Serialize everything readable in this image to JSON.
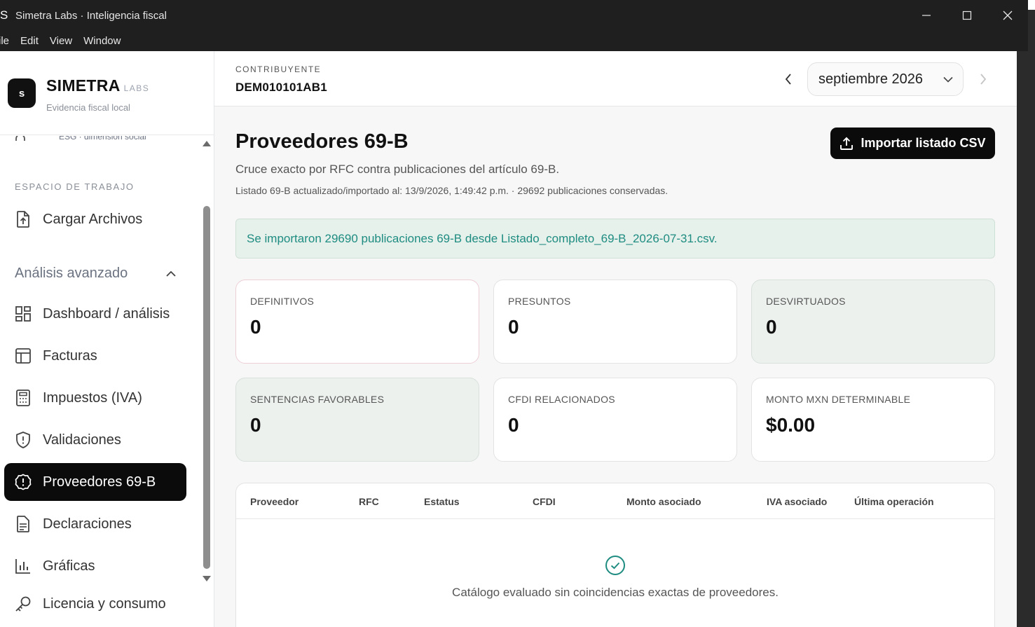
{
  "window": {
    "app_glyph": "S",
    "title": "Simetra Labs · Inteligencia fiscal",
    "controls": [
      "minimize-icon",
      "maximize-icon",
      "close-icon"
    ]
  },
  "menu": [
    "ile",
    "Edit",
    "View",
    "Window"
  ],
  "brand": {
    "logo": "s",
    "name": "SIMETRA",
    "suffix": "LABS",
    "tagline": "Evidencia fiscal local"
  },
  "sidebar": {
    "partial_item_sub": "ESG · dimensión social",
    "section_label": "ESPACIO DE TRABAJO",
    "workspace_item": {
      "label": "Cargar Archivos",
      "icon": "file-upload-icon"
    },
    "group_label": "Análisis avanzado",
    "items": [
      {
        "label": "Dashboard / análisis",
        "icon": "dashboard-icon"
      },
      {
        "label": "Facturas",
        "icon": "table-icon"
      },
      {
        "label": "Impuestos (IVA)",
        "icon": "calculator-icon"
      },
      {
        "label": "Validaciones",
        "icon": "shield-icon"
      },
      {
        "label": "Proveedores 69-B",
        "icon": "alert-circle-icon",
        "active": true
      },
      {
        "label": "Declaraciones",
        "icon": "document-icon"
      },
      {
        "label": "Gráficas",
        "icon": "bar-chart-icon"
      },
      {
        "label": "Licencia y consumo",
        "icon": "key-icon"
      }
    ]
  },
  "header": {
    "contributor_label": "CONTRIBUYENTE",
    "contributor_rfc": "DEM010101AB1",
    "period": "septiembre 2026"
  },
  "page": {
    "title": "Proveedores 69-B",
    "subtitle": "Cruce exacto por RFC contra publicaciones del artículo 69-B.",
    "meta": "Listado 69-B actualizado/importado al: 13/9/2026, 1:49:42 p.m. · 29692 publicaciones conservadas.",
    "import_button": "Importar listado CSV",
    "alert": "Se importaron 29690 publicaciones 69-B desde Listado_completo_69-B_2026-07-31.csv."
  },
  "stats": [
    {
      "label": "DEFINITIVOS",
      "value": "0"
    },
    {
      "label": "PRESUNTOS",
      "value": "0"
    },
    {
      "label": "DESVIRTUADOS",
      "value": "0"
    },
    {
      "label": "SENTENCIAS FAVORABLES",
      "value": "0"
    },
    {
      "label": "CFDI RELACIONADOS",
      "value": "0"
    },
    {
      "label": "MONTO MXN DETERMINABLE",
      "value": "$0.00"
    }
  ],
  "table": {
    "columns": [
      "Proveedor",
      "RFC",
      "Estatus",
      "CFDI",
      "Monto asociado",
      "IVA asociado",
      "Última operación"
    ],
    "rows": [],
    "empty_message": "Catálogo evaluado sin coincidencias exactas de proveedores."
  },
  "colors": {
    "active_nav": "#0b0b0b",
    "alert_bg": "#e7f1ec",
    "alert_text": "#1e8c80",
    "success_icon": "#1e8c80"
  }
}
